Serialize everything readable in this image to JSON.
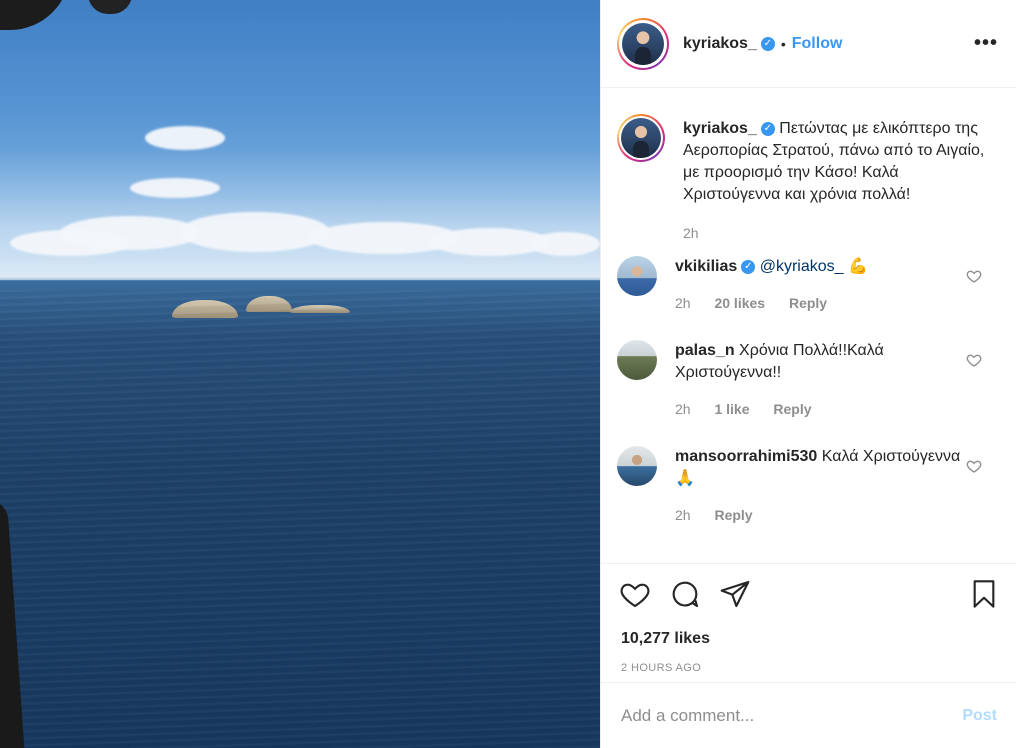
{
  "post": {
    "username": "kyriakos_",
    "follow_label": "Follow",
    "separator": "•",
    "more_label": "•••",
    "caption": "Πετώντας με ελικόπτερο της Αεροπορίας Στρατού, πάνω από το Αιγαίο, με προορισμό την Κάσο! Καλά Χριστούγεννα και χρόνια πολλά!",
    "caption_time": "2h",
    "likes": "10,277 likes",
    "posted_ago": "2 HOURS AGO"
  },
  "comments": [
    {
      "username": "vkikilias",
      "verified": true,
      "mention": "@kyriakos_",
      "text": "💪",
      "time": "2h",
      "likes": "20 likes",
      "reply": "Reply"
    },
    {
      "username": "palas_n",
      "verified": false,
      "text": "Χρόνια Πολλά!!Καλά Χριστούγεννα!!",
      "time": "2h",
      "likes": "1 like",
      "reply": "Reply"
    },
    {
      "username": "mansoorrahimi530",
      "verified": false,
      "text": "Καλά Χριστούγεννα 🙏",
      "time": "2h",
      "reply": "Reply"
    }
  ],
  "comment_box": {
    "placeholder": "Add a comment...",
    "post_label": "Post"
  },
  "colors": {
    "accent": "#3897f0",
    "text": "#262626",
    "muted": "#8e8e8e",
    "post_disabled": "#b3dbff"
  },
  "icons": [
    "heart-icon",
    "comment-icon",
    "share-icon",
    "bookmark-icon",
    "verified-icon",
    "more-icon"
  ]
}
